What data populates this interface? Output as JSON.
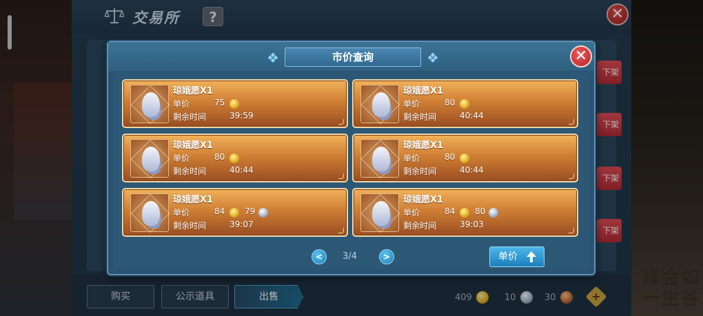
{
  "exchange": {
    "title": "交易所",
    "help_label": "?",
    "close_label": "✕",
    "unlist_label": "下架",
    "tabs": [
      {
        "label": "购买"
      },
      {
        "label": "公示道具"
      },
      {
        "label": "出售"
      }
    ],
    "currency": [
      {
        "amount": "409",
        "type": "gold"
      },
      {
        "amount": "10",
        "type": "silver"
      },
      {
        "amount": "30",
        "type": "copper"
      }
    ],
    "add_label": "+"
  },
  "modal": {
    "title": "市价查询",
    "close_label": "✕",
    "price_label": "单价",
    "time_label": "剩余时间",
    "listings": [
      {
        "name": "琼娥愿X1",
        "gold_price": "75",
        "silver_price": "",
        "time_left": "39:59"
      },
      {
        "name": "琼娥愿X1",
        "gold_price": "80",
        "silver_price": "",
        "time_left": "40:44"
      },
      {
        "name": "琼娥愿X1",
        "gold_price": "80",
        "silver_price": "",
        "time_left": "40:44"
      },
      {
        "name": "琼娥愿X1",
        "gold_price": "80",
        "silver_price": "",
        "time_left": "40:44"
      },
      {
        "name": "琼娥愿X1",
        "gold_price": "84",
        "silver_price": "79",
        "time_left": "39:07"
      },
      {
        "name": "琼娥愿X1",
        "gold_price": "84",
        "silver_price": "80",
        "time_left": "39:03"
      }
    ],
    "pager": {
      "text": "3/4",
      "prev": "<",
      "next": ">"
    },
    "sort_button": "单价"
  },
  "background_text": "择金如\n一生谷",
  "colors": {
    "card_gold": "#cf7f34",
    "modal_blue": "#2b5472",
    "close_red": "#b12129",
    "accent_blue": "#1d7fbb"
  }
}
